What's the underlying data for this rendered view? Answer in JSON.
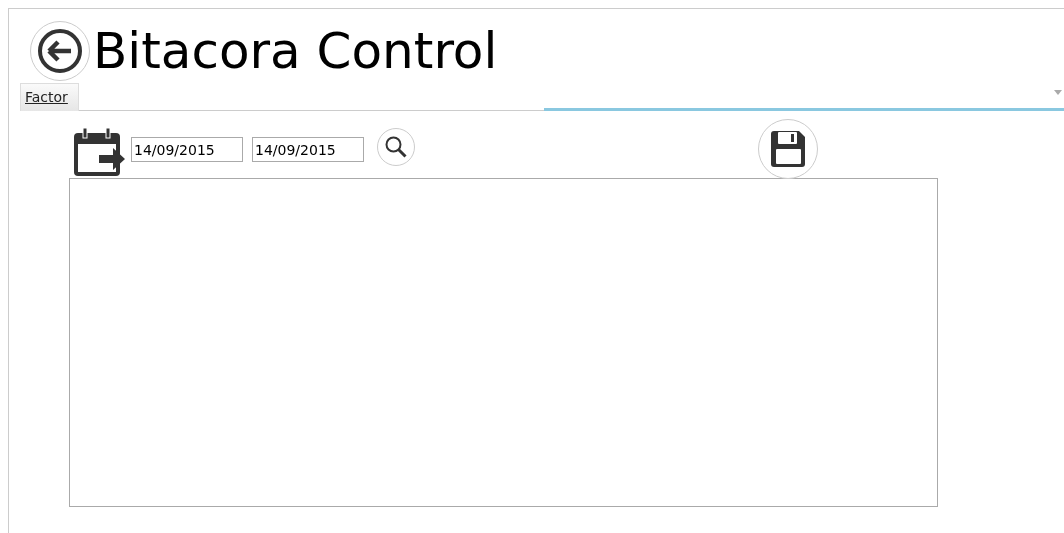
{
  "title": "Bitacora Control",
  "tabs": [
    {
      "label": "Factor",
      "selected": true
    }
  ],
  "filters": {
    "date_from": "14/09/2015",
    "date_to": "14/09/2015"
  }
}
